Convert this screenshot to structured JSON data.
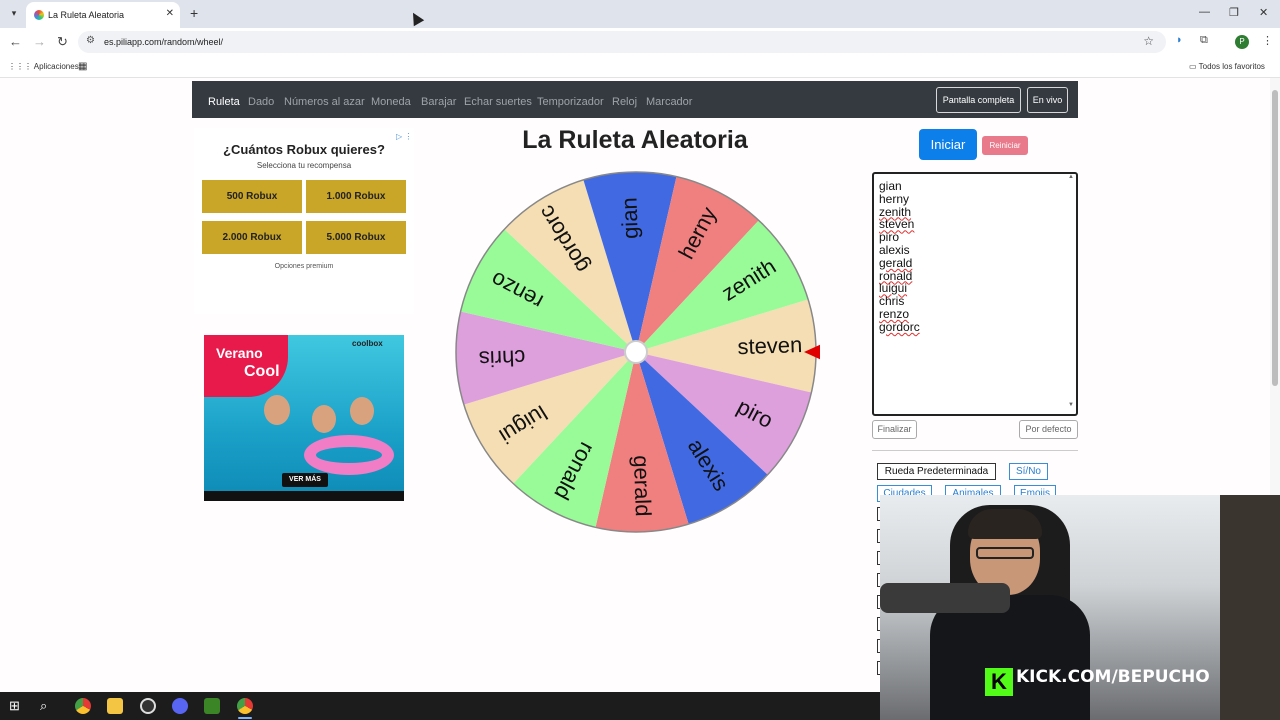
{
  "browser": {
    "tab_title": "La Ruleta Aleatoria",
    "url": "es.piliapp.com/random/wheel/",
    "bookmarks": {
      "apps": "Aplicaciones",
      "favorites": "Todos los favoritos"
    }
  },
  "site_nav": {
    "items": [
      "Ruleta",
      "Dado",
      "Números al azar",
      "Moneda",
      "Barajar",
      "Echar suertes",
      "Temporizador",
      "Reloj",
      "Marcador"
    ],
    "fullscreen": "Pantalla completa",
    "live": "En vivo"
  },
  "ad_robux": {
    "title": "¿Cuántos Robux quieres?",
    "subtitle": "Selecciona tu recompensa",
    "options": [
      "500 Robux",
      "1.000 Robux",
      "2.000 Robux",
      "5.000 Robux"
    ],
    "premium": "Opciones premium"
  },
  "ad_summer": {
    "line1": "Verano",
    "line2": "Cool",
    "brand": "coolbox",
    "cta": "VER MÁS"
  },
  "wheel": {
    "title": "La Ruleta Aleatoria",
    "segments": [
      {
        "label": "steven",
        "color": "#f5deb3"
      },
      {
        "label": "piro",
        "color": "#dda0dd"
      },
      {
        "label": "alexis",
        "color": "#4169e1"
      },
      {
        "label": "gerald",
        "color": "#f08080"
      },
      {
        "label": "ronald",
        "color": "#98fb98"
      },
      {
        "label": "luigui",
        "color": "#f5deb3"
      },
      {
        "label": "chris",
        "color": "#dda0dd"
      },
      {
        "label": "renzo",
        "color": "#98fb98"
      },
      {
        "label": "gordorc",
        "color": "#f5deb3"
      },
      {
        "label": "gian",
        "color": "#4169e1"
      },
      {
        "label": "herny",
        "color": "#f08080"
      },
      {
        "label": "zenith",
        "color": "#98fb98"
      }
    ],
    "pointer_color": "#e00000"
  },
  "controls": {
    "start": "Iniciar",
    "reset": "Reiniciar",
    "finish": "Finalizar",
    "default": "Por defecto"
  },
  "names": [
    "gian",
    "herny",
    "zenith",
    "steven",
    "piro",
    "alexis",
    "gerald",
    "ronald",
    "luigui",
    "chris",
    "renzo",
    "gordorc"
  ],
  "presets": {
    "default_wheel": "Rueda Predeterminada",
    "yes_no": "Sí/No",
    "cities": "Ciudades",
    "animals": "Animales",
    "emojis": "Emojis"
  },
  "stream": {
    "url": "KICK.COM/BEPUCHO",
    "logo": "K"
  }
}
